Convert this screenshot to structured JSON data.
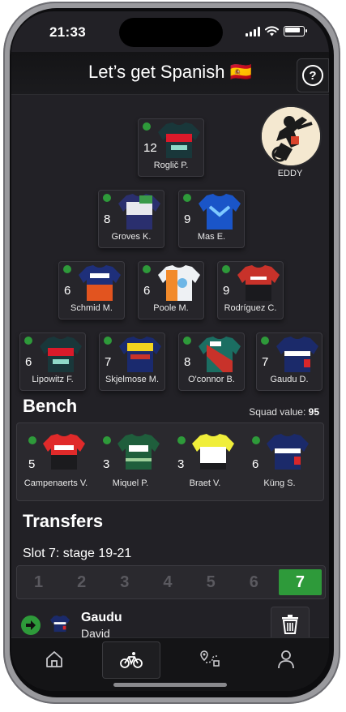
{
  "status": {
    "time": "21:33"
  },
  "header": {
    "title": "Let’s get Spanish 🇪🇸",
    "help_symbol": "?"
  },
  "coach": {
    "label": "EDDY"
  },
  "lineup": [
    {
      "num": "12",
      "name": "Roglič P.",
      "team": "bora"
    },
    {
      "num": "8",
      "name": "Groves K.",
      "team": "alpecin"
    },
    {
      "num": "9",
      "name": "Mas E.",
      "team": "movistar"
    },
    {
      "num": "6",
      "name": "Schmid M.",
      "team": "jayco"
    },
    {
      "num": "6",
      "name": "Poole M.",
      "team": "dsm"
    },
    {
      "num": "9",
      "name": "Rodríguez C.",
      "team": "ineos"
    },
    {
      "num": "6",
      "name": "Lipowitz F.",
      "team": "bora"
    },
    {
      "num": "7",
      "name": "Skjelmose M.",
      "team": "trek"
    },
    {
      "num": "8",
      "name": "O'connor B.",
      "team": "decathlon"
    },
    {
      "num": "7",
      "name": "Gaudu D.",
      "team": "groupama"
    }
  ],
  "bench": {
    "title": "Bench",
    "squad_label": "Squad value:",
    "squad_value": "95",
    "players": [
      {
        "num": "5",
        "name": "Campenaerts V.",
        "team": "lotto"
      },
      {
        "num": "3",
        "name": "Miquel P.",
        "team": "kern"
      },
      {
        "num": "3",
        "name": "Braet V.",
        "team": "intermarche"
      },
      {
        "num": "6",
        "name": "Küng S.",
        "team": "groupama"
      }
    ]
  },
  "transfers": {
    "title": "Transfers",
    "slot_label": "Slot 7: stage 19-21",
    "slots": [
      "1",
      "2",
      "3",
      "4",
      "5",
      "6",
      "7"
    ],
    "active_slot": "7",
    "current": {
      "last_name": "Gaudu",
      "first_name": "David",
      "team": "groupama"
    }
  },
  "tabs": [
    {
      "icon": "home-icon"
    },
    {
      "icon": "bike-icon",
      "active": true
    },
    {
      "icon": "route-icon"
    },
    {
      "icon": "profile-icon"
    }
  ],
  "colors": {
    "accent_green": "#2e9a3a",
    "background": "#222126",
    "card": "#26252a"
  }
}
